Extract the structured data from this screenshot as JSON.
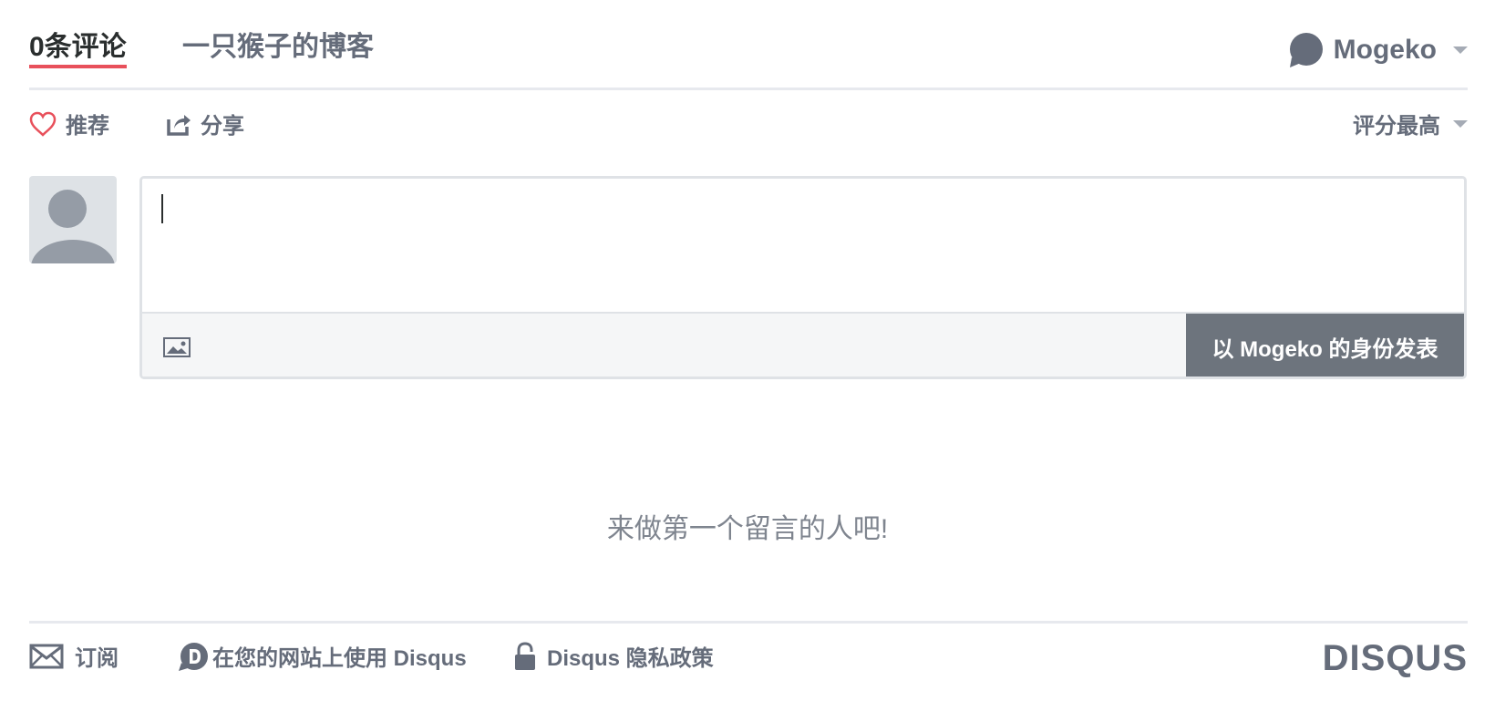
{
  "tabs": {
    "count_label": "0条评论",
    "community_label": "一只猴子的博客"
  },
  "user": {
    "name": "Mogeko"
  },
  "toolbar": {
    "recommend_label": "推荐",
    "share_label": "分享",
    "sort_label": "评分最高"
  },
  "composer": {
    "post_button_label": "以 Mogeko 的身份发表"
  },
  "empty_message": "来做第一个留言的人吧!",
  "footer": {
    "subscribe_label": "订阅",
    "add_disqus_label": "在您的网站上使用 Disqus",
    "privacy_label": "Disqus 隐私政策",
    "logo_text": "DISQUS"
  },
  "colors": {
    "accent_red": "#e8505b",
    "text_gray": "#656c7a",
    "post_button_bg": "#6d747d"
  },
  "icons": [
    "chat-bubble-icon",
    "heart-icon",
    "share-icon",
    "image-icon",
    "mail-icon",
    "disqus-d-icon",
    "lock-icon"
  ]
}
